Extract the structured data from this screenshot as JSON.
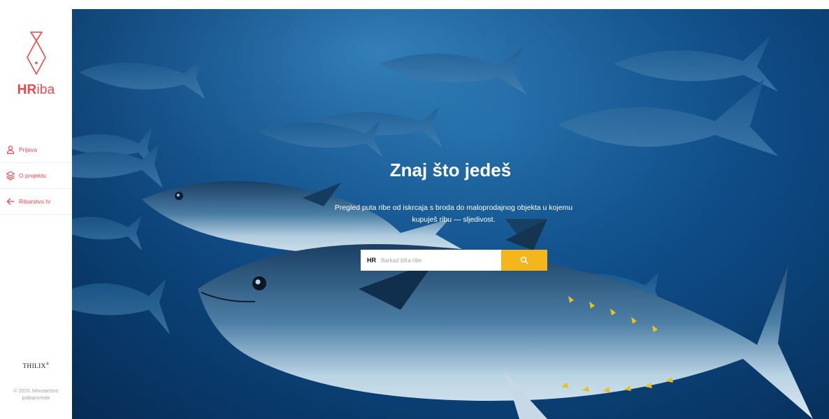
{
  "brand": {
    "logo_strong": "HR",
    "logo_light": "iba",
    "accent_color": "#e8484b"
  },
  "sidebar": {
    "items": [
      {
        "label": "Prijava",
        "icon": "user-icon"
      },
      {
        "label": "O projektu",
        "icon": "layers-icon"
      },
      {
        "label": "Ribarstvo.hr",
        "icon": "arrow-left-icon"
      }
    ],
    "partner": "THILIX",
    "partner_mark": "®",
    "copyright": "© 2020. Ministarstvo poljoprivrede"
  },
  "hero": {
    "title": "Znaj što jedeš",
    "description": "Pregled puta ribe od iskrcaja s broda do maloprodajnog objekta u kojemu kupuješ ribu — sljedivost.",
    "background": "underwater-tuna-school"
  },
  "search": {
    "prefix": "HR",
    "placeholder": "Barkod šifra ribe",
    "value": "",
    "button_icon": "search-icon",
    "button_color": "#f5b51d"
  }
}
